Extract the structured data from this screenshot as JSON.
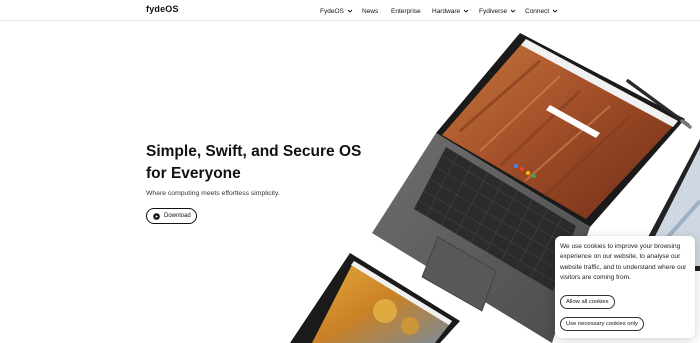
{
  "header": {
    "logo": "fydeOS",
    "nav": [
      {
        "label": "FydeOS",
        "has_dropdown": true
      },
      {
        "label": "News",
        "has_dropdown": false
      },
      {
        "label": "Enterprise",
        "has_dropdown": false
      },
      {
        "label": "Hardware",
        "has_dropdown": true
      },
      {
        "label": "Fydiverse",
        "has_dropdown": true
      },
      {
        "label": "Connect",
        "has_dropdown": true
      }
    ]
  },
  "hero": {
    "title_line1": "Simple, Swift, and Secure OS",
    "title_line2": "for Everyone",
    "subtitle": "Where computing meets effortless simplicity.",
    "download_label": "Download",
    "download_icon": "play-circle-icon"
  },
  "cookie": {
    "text": "We use cookies to improve your browsing experience on our website, to analyse our website traffic, and to understand where our visitors are coming from.",
    "allow_label": "Allow all cookies",
    "necessary_label": "Use necessary cookies only"
  },
  "colors": {
    "accent": "#111111",
    "laptop_body": "#5c5c5c",
    "keyboard": "#2a2a2a",
    "wallpaper": "#b35a2a"
  }
}
